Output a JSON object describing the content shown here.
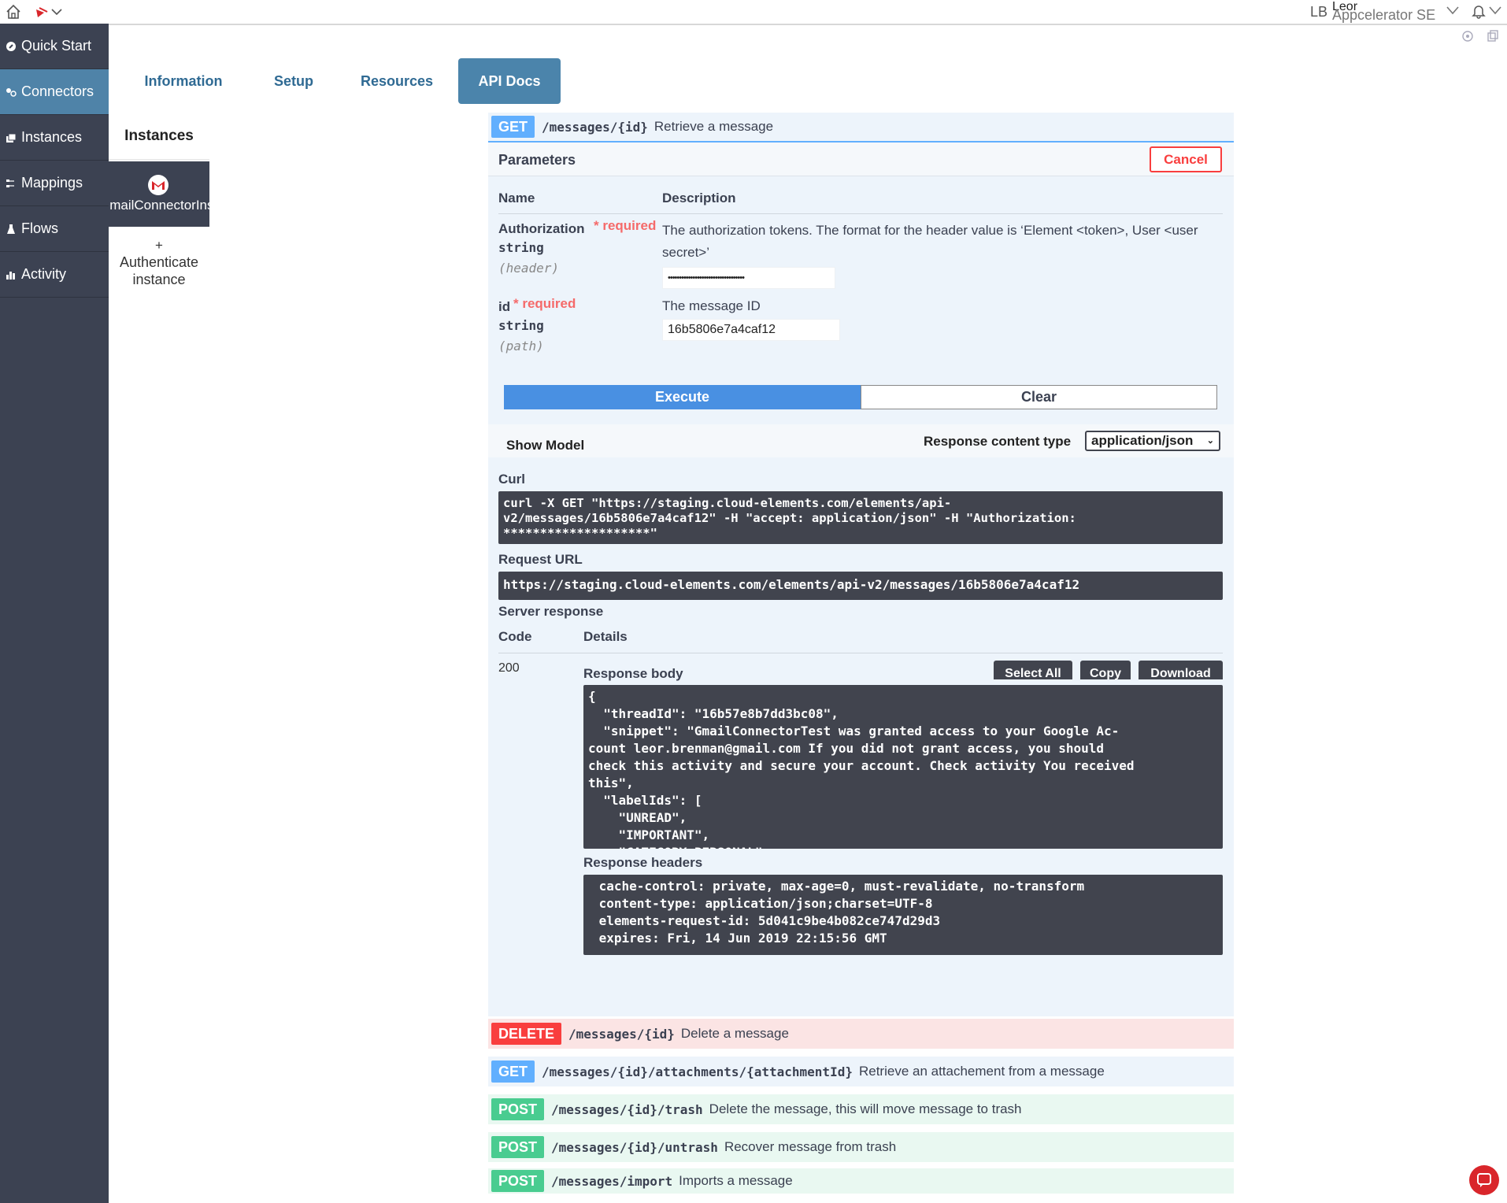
{
  "header": {
    "user_initials": "LB",
    "user_name": "Leor",
    "org_name": "Appcelerator SE"
  },
  "sidebar": {
    "items": [
      {
        "label": "Quick Start",
        "icon": "rocket-icon"
      },
      {
        "label": "Connectors",
        "icon": "plug-icon"
      },
      {
        "label": "Instances",
        "icon": "stack-icon"
      },
      {
        "label": "Mappings",
        "icon": "mapping-icon"
      },
      {
        "label": "Flows",
        "icon": "flask-icon"
      },
      {
        "label": "Activity",
        "icon": "bar-chart-icon"
      }
    ],
    "active": "Connectors"
  },
  "tabs": [
    {
      "label": "Information"
    },
    {
      "label": "Setup"
    },
    {
      "label": "Resources"
    },
    {
      "label": "API Docs"
    }
  ],
  "instances_panel": {
    "title": "Instances",
    "instance_label": "GmailConnectorInstance",
    "authenticate_plus": "+",
    "authenticate_label": "Authenticate instance"
  },
  "operation": {
    "method": "GET",
    "path": "/messages/{id}",
    "summary": "Retrieve a message",
    "parameters_title": "Parameters",
    "cancel_label": "Cancel",
    "col_name": "Name",
    "col_description": "Description",
    "params": [
      {
        "name": "Authorization",
        "required": "* required",
        "type": "string",
        "location": "(header)",
        "description": "The authorization tokens. The format for the header value is ‘Element <token>, User <user secret>’",
        "value": "••••••••••••••••••••••••••••••••••"
      },
      {
        "name": "id",
        "required": "* required",
        "type": "string",
        "location": "(path)",
        "description": "The message ID",
        "value": "16b5806e7a4caf12"
      }
    ],
    "execute_label": "Execute",
    "clear_label": "Clear",
    "show_model_label": "Show Model",
    "response_content_type_label": "Response content type",
    "response_content_type_value": "application/json",
    "curl_label": "Curl",
    "curl": "curl -X GET \"https://staging.cloud-elements.com/elements/api-\nv2/messages/16b5806e7a4caf12\" -H \"accept: application/json\" -H \"Authorization:\n********************\"",
    "request_url_label": "Request URL",
    "request_url": "https://staging.cloud-elements.com/elements/api-v2/messages/16b5806e7a4caf12",
    "server_response_label": "Server response",
    "code_header": "Code",
    "details_header": "Details",
    "response_code": "200",
    "response_body_label": "Response body",
    "select_all_label": "Select All",
    "copy_label": "Copy",
    "download_label": "Download",
    "response_body": "{\n  \"threadId\": \"16b57e8b7dd3bc08\",\n  \"snippet\": \"GmailConnectorTest was granted access to your Google Ac-\ncount leor.brenman@gmail.com If you did not grant access, you should\ncheck this activity and secure your account. Check activity You received\nthis\",\n  \"labelIds\": [\n    \"UNREAD\",\n    \"IMPORTANT\",\n    \"CATEGORY_PERSONAL\",\n    \"INBOX\"\n  ],",
    "response_headers_label": "Response headers",
    "response_headers": " cache-control: private, max-age=0, must-revalidate, no-transform\n content-type: application/json;charset=UTF-8\n elements-request-id: 5d041c9be4b082ce747d29d3\n expires: Fri, 14 Jun 2019 22:15:56 GMT"
  },
  "other_operations": [
    {
      "method": "DELETE",
      "path": "/messages/{id}",
      "summary": "Delete a message"
    },
    {
      "method": "GET",
      "path": "/messages/{id}/attachments/{attachmentId}",
      "summary": "Retrieve an attachement from a message"
    },
    {
      "method": "POST",
      "path": "/messages/{id}/trash",
      "summary": "Delete the message, this will move message to trash"
    },
    {
      "method": "POST",
      "path": "/messages/{id}/untrash",
      "summary": "Recover message from trash"
    },
    {
      "method": "POST",
      "path": "/messages/import",
      "summary": "Imports a message"
    }
  ],
  "colors": {
    "sidebar_bg": "#3c4252",
    "sidebar_active": "#4f83a8",
    "get": "#61affe",
    "delete": "#f93e3e",
    "post": "#49cc90",
    "execute": "#4990e2"
  }
}
